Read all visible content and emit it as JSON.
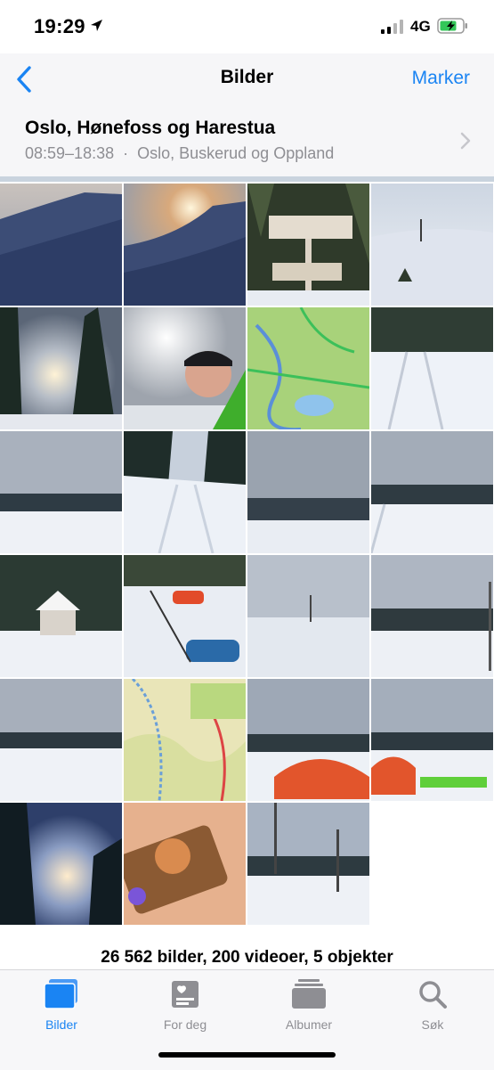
{
  "status": {
    "time": "19:29",
    "network": "4G",
    "icons": [
      "location-arrow-icon",
      "signal-bars-icon",
      "battery-charging-icon"
    ]
  },
  "nav": {
    "back_icon": "chevron-left-icon",
    "title": "Bilder",
    "select_label": "Marker"
  },
  "moment": {
    "title": "Oslo, Hønefoss og Harestua",
    "time_range": "08:59–18:38",
    "separator": "·",
    "locations": "Oslo, Buskerud og Oppland",
    "chevron_icon": "chevron-right-icon"
  },
  "photos": [
    "snow-drift",
    "snow-drift-sunset",
    "trail-signpost",
    "snow-field-tree",
    "forest-sun",
    "selfie-helmet",
    "topographic-map",
    "snowy-trail-forest",
    "cloudy-valley",
    "groomed-ski-track",
    "snowy-valley-view",
    "ski-track-valley",
    "snowy-cabin",
    "pulk-sled-skiing",
    "foggy-snow-field",
    "snowy-meadow-trees",
    "snowy-plain-treeline",
    "trail-map",
    "red-tent-camp",
    "red-tent-sleds",
    "forest-sunset",
    "camp-stove-cup",
    "snow-camp-trees"
  ],
  "summary": "26 562 bilder, 200 videoer, 5 objekter",
  "tabs": [
    {
      "label": "Bilder",
      "icon": "photos-icon",
      "active": true
    },
    {
      "label": "For deg",
      "icon": "for-you-icon",
      "active": false
    },
    {
      "label": "Albumer",
      "icon": "albums-icon",
      "active": false
    },
    {
      "label": "Søk",
      "icon": "search-icon",
      "active": false
    }
  ],
  "colors": {
    "accent": "#1a84f3",
    "secondary_text": "#8e8e93",
    "tent": "#e2552c",
    "map_green": "#a8d27a"
  }
}
